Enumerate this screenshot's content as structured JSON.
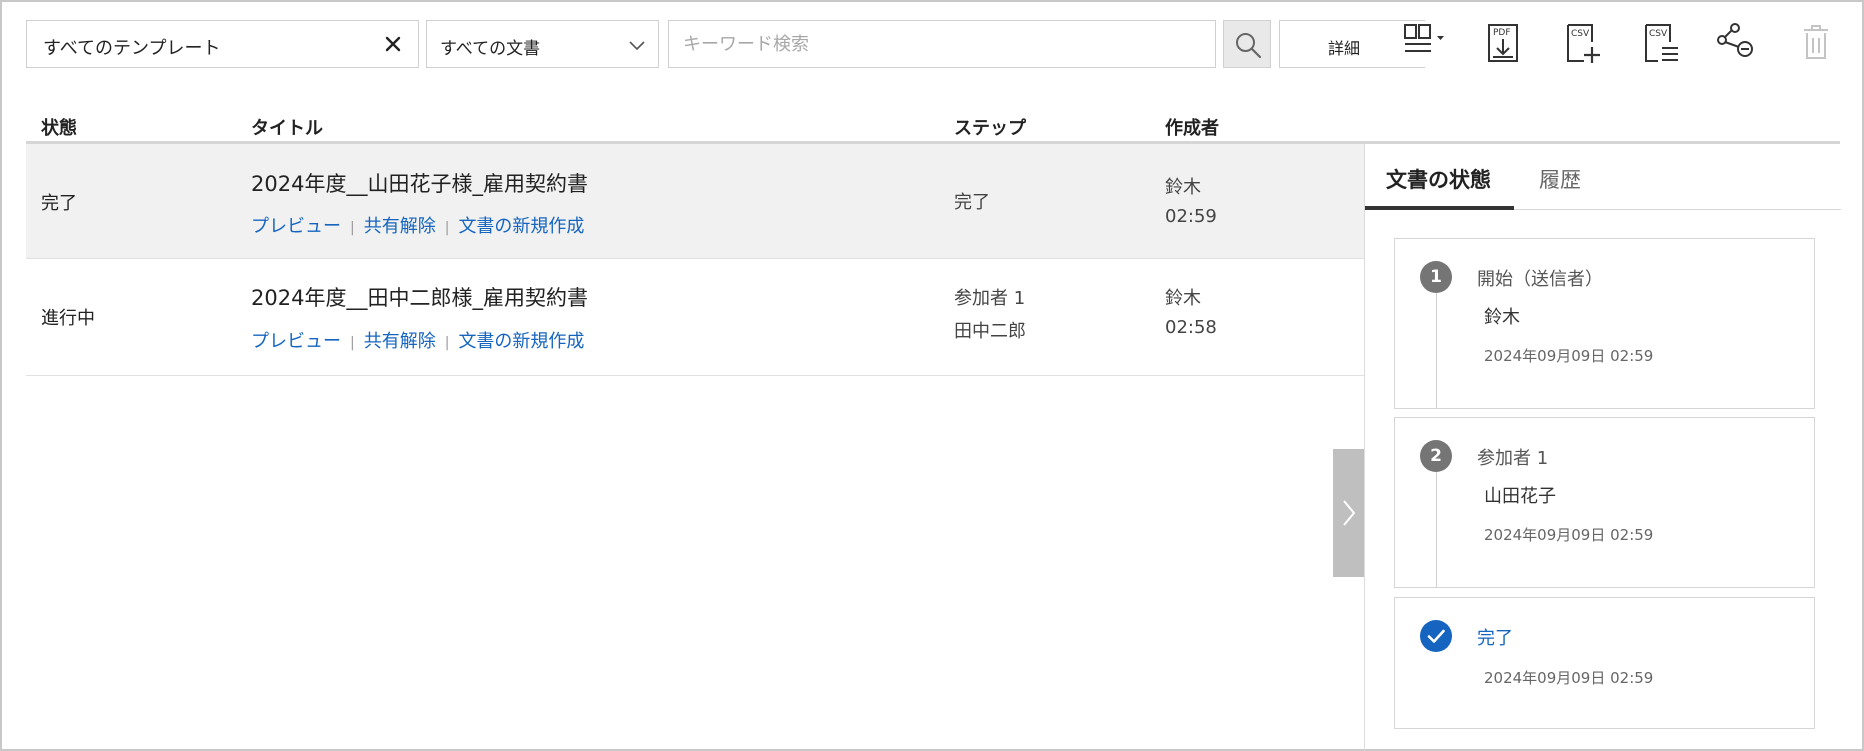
{
  "toolbar": {
    "template_filter": "すべてのテンプレート",
    "document_filter": "すべての文書",
    "keyword_placeholder": "キーワード検索",
    "detail_label": "詳細"
  },
  "table": {
    "headers": {
      "status": "状態",
      "title": "タイトル",
      "step": "ステップ",
      "author": "作成者"
    },
    "link_labels": {
      "preview": "プレビュー",
      "unshare": "共有解除",
      "new_document": "文書の新規作成"
    },
    "rows": [
      {
        "status": "完了",
        "title": "2024年度__山田花子様_雇用契約書",
        "step_line1": "完了",
        "step_line2": "",
        "author": "鈴木",
        "time": "02:59"
      },
      {
        "status": "進行中",
        "title": "2024年度__田中二郎様_雇用契約書",
        "step_line1": "参加者 1",
        "step_line2": "田中二郎",
        "author": "鈴木",
        "time": "02:58"
      }
    ]
  },
  "panel": {
    "tabs": {
      "status": "文書の状態",
      "history": "履歴"
    },
    "steps": [
      {
        "number": "1",
        "label": "開始（送信者）",
        "name": "鈴木",
        "date": "2024年09月09日 02:59"
      },
      {
        "number": "2",
        "label": "参加者 1",
        "name": "山田花子",
        "date": "2024年09月09日 02:59"
      },
      {
        "label": "完了",
        "date": "2024年09月09日 02:59"
      }
    ]
  },
  "icons": [
    "close-icon",
    "chevron-down-icon",
    "search-icon",
    "layout-columns-icon",
    "pdf-download-icon",
    "csv-add-icon",
    "csv-list-icon",
    "unshare-icon",
    "trash-icon",
    "chevron-right-icon",
    "check-icon"
  ],
  "colors": {
    "link": "#1565c0",
    "step_badge": "#757575",
    "selected_row": "#f1f1f1"
  }
}
